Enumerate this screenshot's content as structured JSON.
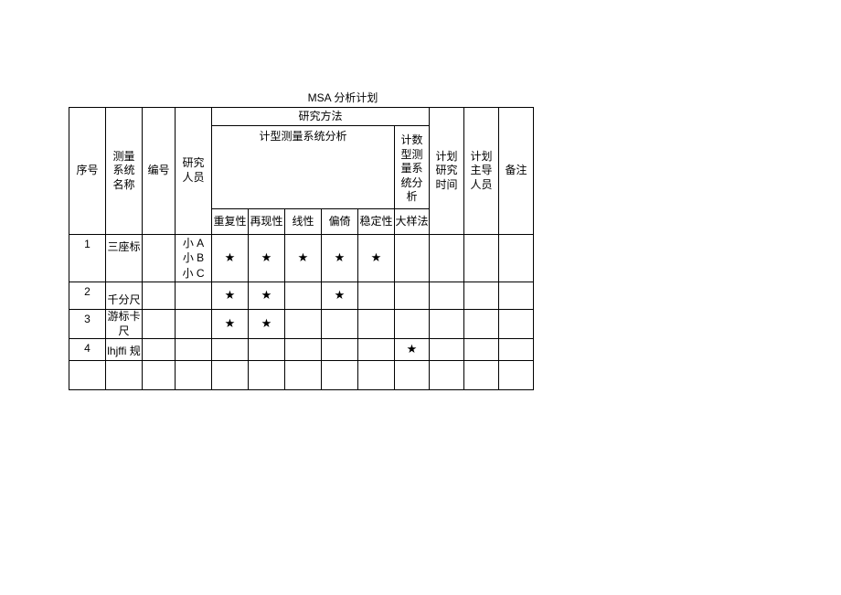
{
  "title": "MSA 分析计划",
  "headers": {
    "seq": "序号",
    "name": "测量系统名称",
    "code": "编号",
    "people": "研究人员",
    "method": "研究方法",
    "quant": "计型测量系统分析",
    "count": "计数型测量系统分析",
    "m1": "重复性",
    "m2": "再现性",
    "m3": "线性",
    "m4": "偏倚",
    "m5": "稳定性",
    "c1": "大样法",
    "time": "计划研究时间",
    "lead": "计划主导人员",
    "note": "备注"
  },
  "star": "★",
  "rows": [
    {
      "seq": "1",
      "name": "三座标",
      "people": "小 A\n小 B\n小 C",
      "m1": true,
      "m2": true,
      "m3": true,
      "m4": true,
      "m5": true,
      "c1": false
    },
    {
      "seq": "2",
      "name": "千分尺",
      "people": "",
      "m1": true,
      "m2": true,
      "m3": false,
      "m4": true,
      "m5": false,
      "c1": false
    },
    {
      "seq": "3",
      "name": "游标卡尺",
      "people": "",
      "m1": true,
      "m2": true,
      "m3": false,
      "m4": false,
      "m5": false,
      "c1": false
    },
    {
      "seq": "4",
      "name": "lhjffi 规",
      "people": "",
      "m1": false,
      "m2": false,
      "m3": false,
      "m4": false,
      "m5": false,
      "c1": true
    }
  ]
}
